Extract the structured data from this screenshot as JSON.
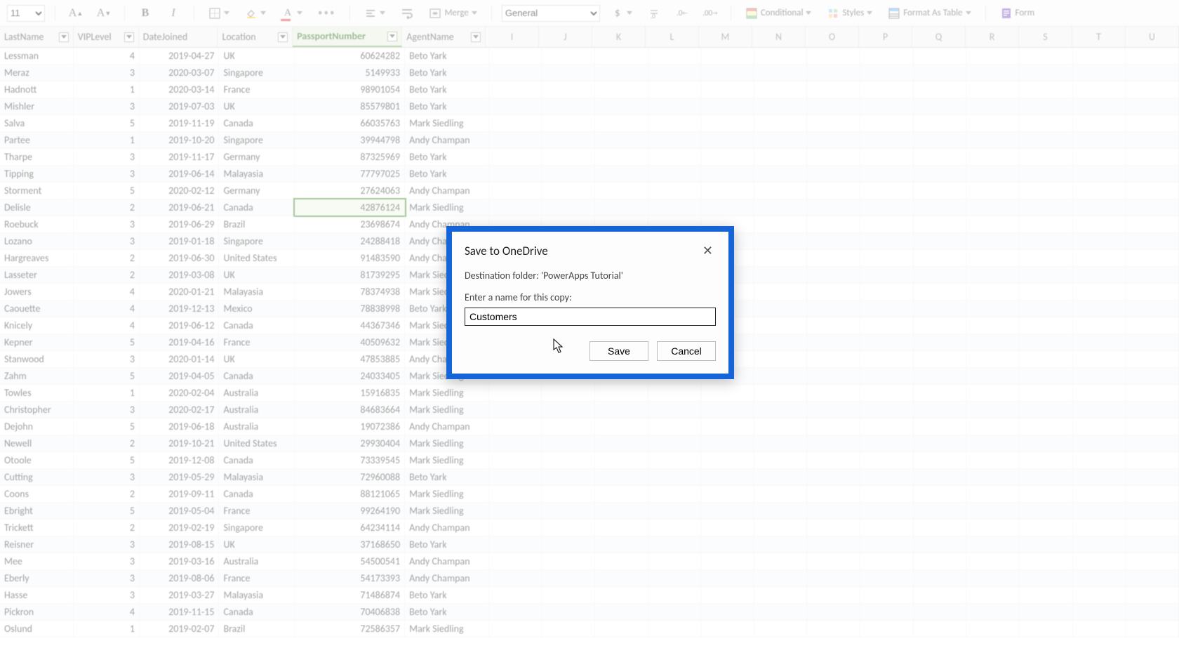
{
  "toolbar": {
    "font_size": "11",
    "merge_label": "Merge",
    "number_format": "General",
    "conditional_label": "Conditional",
    "styles_label": "Styles",
    "format_table_label": "Format As Table",
    "form_label": "Form"
  },
  "headers": {
    "lastname": "LastName",
    "viplevel": "VIPLevel",
    "datejoined": "DateJoined",
    "location": "Location",
    "passport": "PassportNumber",
    "agent": "AgentName",
    "letters": [
      "I",
      "J",
      "K",
      "L",
      "M",
      "N",
      "O",
      "P",
      "Q",
      "R",
      "S",
      "T",
      "U"
    ]
  },
  "rows": [
    {
      "last": "Lessman",
      "vip": "4",
      "date": "2019-04-27",
      "loc": "UK",
      "pass": "60624282",
      "agent": "Beto Yark"
    },
    {
      "last": "Meraz",
      "vip": "3",
      "date": "2020-03-07",
      "loc": "Singapore",
      "pass": "5149933",
      "agent": "Beto Yark"
    },
    {
      "last": "Hadnott",
      "vip": "1",
      "date": "2020-03-14",
      "loc": "France",
      "pass": "98901054",
      "agent": "Beto Yark"
    },
    {
      "last": "Mishler",
      "vip": "3",
      "date": "2019-07-03",
      "loc": "UK",
      "pass": "85579801",
      "agent": "Beto Yark"
    },
    {
      "last": "Salva",
      "vip": "5",
      "date": "2019-11-19",
      "loc": "Canada",
      "pass": "66035763",
      "agent": "Mark Siedling"
    },
    {
      "last": "Partee",
      "vip": "1",
      "date": "2019-10-20",
      "loc": "Singapore",
      "pass": "39944798",
      "agent": "Andy Champan"
    },
    {
      "last": "Tharpe",
      "vip": "3",
      "date": "2019-11-17",
      "loc": "Germany",
      "pass": "87325969",
      "agent": "Beto Yark"
    },
    {
      "last": "Tipping",
      "vip": "3",
      "date": "2019-06-14",
      "loc": "Malayasia",
      "pass": "77797025",
      "agent": "Beto Yark"
    },
    {
      "last": "Storment",
      "vip": "5",
      "date": "2020-02-12",
      "loc": "Germany",
      "pass": "27624063",
      "agent": "Andy Champan"
    },
    {
      "last": "Delisle",
      "vip": "2",
      "date": "2019-06-21",
      "loc": "Canada",
      "pass": "42876124",
      "agent": "Mark Siedling",
      "selected": true
    },
    {
      "last": "Roebuck",
      "vip": "3",
      "date": "2019-06-29",
      "loc": "Brazil",
      "pass": "23698674",
      "agent": "Andy Champan"
    },
    {
      "last": "Lozano",
      "vip": "3",
      "date": "2019-01-18",
      "loc": "Singapore",
      "pass": "24288418",
      "agent": "Andy Champan"
    },
    {
      "last": "Hargreaves",
      "vip": "2",
      "date": "2019-06-30",
      "loc": "United States",
      "pass": "91483590",
      "agent": "Andy Champan"
    },
    {
      "last": "Lasseter",
      "vip": "2",
      "date": "2019-03-08",
      "loc": "UK",
      "pass": "81739295",
      "agent": "Mark Siedling"
    },
    {
      "last": "Jowers",
      "vip": "4",
      "date": "2020-01-21",
      "loc": "Malayasia",
      "pass": "78374938",
      "agent": "Mark Siedling"
    },
    {
      "last": "Caouette",
      "vip": "4",
      "date": "2019-12-13",
      "loc": "Mexico",
      "pass": "78838998",
      "agent": "Beto Yark"
    },
    {
      "last": "Knicely",
      "vip": "4",
      "date": "2019-06-12",
      "loc": "Canada",
      "pass": "44367346",
      "agent": "Mark Siedling"
    },
    {
      "last": "Kepner",
      "vip": "5",
      "date": "2019-04-16",
      "loc": "France",
      "pass": "40509632",
      "agent": "Mark Siedling"
    },
    {
      "last": "Stanwood",
      "vip": "3",
      "date": "2020-01-14",
      "loc": "UK",
      "pass": "47853885",
      "agent": "Andy Champan"
    },
    {
      "last": "Zahm",
      "vip": "5",
      "date": "2019-04-05",
      "loc": "Canada",
      "pass": "24033405",
      "agent": "Mark Siedling"
    },
    {
      "last": "Towles",
      "vip": "1",
      "date": "2020-02-04",
      "loc": "Australia",
      "pass": "15916835",
      "agent": "Mark Siedling"
    },
    {
      "last": "Christopher",
      "vip": "3",
      "date": "2020-02-17",
      "loc": "Australia",
      "pass": "84683664",
      "agent": "Mark Siedling"
    },
    {
      "last": "Dejohn",
      "vip": "5",
      "date": "2019-06-18",
      "loc": "Australia",
      "pass": "19072386",
      "agent": "Andy Champan"
    },
    {
      "last": "Newell",
      "vip": "2",
      "date": "2019-10-21",
      "loc": "United States",
      "pass": "29930404",
      "agent": "Mark Siedling"
    },
    {
      "last": "Otoole",
      "vip": "5",
      "date": "2019-12-08",
      "loc": "Canada",
      "pass": "73339545",
      "agent": "Mark Siedling"
    },
    {
      "last": "Cutting",
      "vip": "3",
      "date": "2019-05-29",
      "loc": "Malayasia",
      "pass": "72960088",
      "agent": "Beto Yark"
    },
    {
      "last": "Coons",
      "vip": "2",
      "date": "2019-09-11",
      "loc": "Canada",
      "pass": "88121065",
      "agent": "Mark Siedling"
    },
    {
      "last": "Ebright",
      "vip": "5",
      "date": "2019-05-04",
      "loc": "France",
      "pass": "99264190",
      "agent": "Mark Siedling"
    },
    {
      "last": "Trickett",
      "vip": "2",
      "date": "2019-02-19",
      "loc": "Singapore",
      "pass": "64234114",
      "agent": "Andy Champan"
    },
    {
      "last": "Reisner",
      "vip": "3",
      "date": "2019-08-15",
      "loc": "UK",
      "pass": "37168650",
      "agent": "Beto Yark"
    },
    {
      "last": "Mee",
      "vip": "3",
      "date": "2019-03-16",
      "loc": "Australia",
      "pass": "54500541",
      "agent": "Andy Champan"
    },
    {
      "last": "Eberly",
      "vip": "3",
      "date": "2019-08-06",
      "loc": "France",
      "pass": "54173393",
      "agent": "Andy Champan"
    },
    {
      "last": "Hasse",
      "vip": "3",
      "date": "2019-03-27",
      "loc": "Malayasia",
      "pass": "71486874",
      "agent": "Beto Yark"
    },
    {
      "last": "Pickron",
      "vip": "4",
      "date": "2019-11-15",
      "loc": "Canada",
      "pass": "70406838",
      "agent": "Beto Yark"
    },
    {
      "last": "Oslund",
      "vip": "1",
      "date": "2019-02-07",
      "loc": "Brazil",
      "pass": "72586357",
      "agent": "Mark Siedling"
    }
  ],
  "dialog": {
    "title": "Save to OneDrive",
    "destination": "Destination folder: 'PowerApps Tutorial'",
    "prompt": "Enter a name for this copy:",
    "value": "Customers",
    "save": "Save",
    "cancel": "Cancel"
  }
}
